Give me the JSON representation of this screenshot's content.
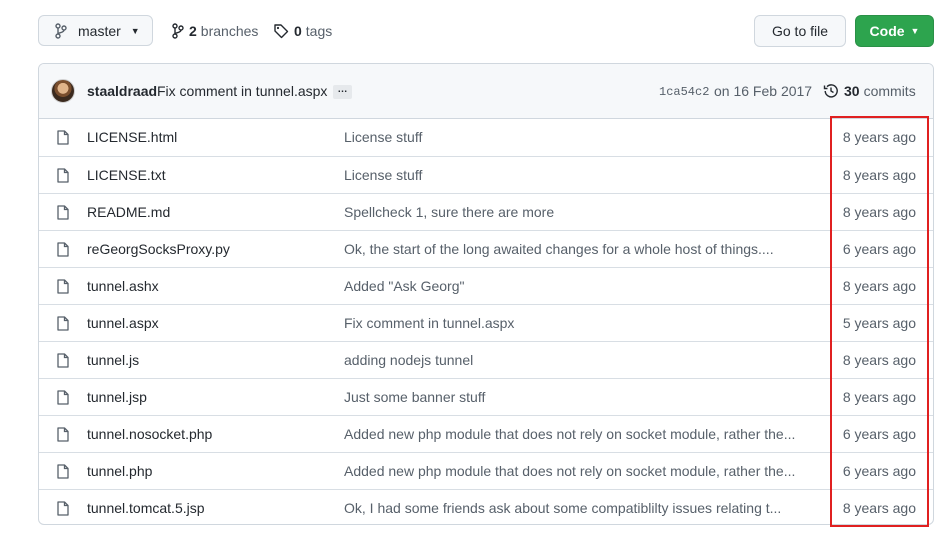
{
  "toolbar": {
    "branch": "master",
    "branches_count": "2",
    "branches_label": "branches",
    "tags_count": "0",
    "tags_label": "tags",
    "goto_file": "Go to file",
    "code": "Code"
  },
  "latest_commit": {
    "author": "staaldraad",
    "message": "Fix comment in tunnel.aspx",
    "ellipsis": "…",
    "sha": "1ca54c2",
    "date": "on 16 Feb 2017",
    "commits_count": "30",
    "commits_label": "commits"
  },
  "files": [
    {
      "name": "LICENSE.html",
      "message": "License stuff",
      "age": "8 years ago"
    },
    {
      "name": "LICENSE.txt",
      "message": "License stuff",
      "age": "8 years ago"
    },
    {
      "name": "README.md",
      "message": "Spellcheck 1, sure there are more",
      "age": "8 years ago"
    },
    {
      "name": "reGeorgSocksProxy.py",
      "message": "Ok, the start of the long awaited changes for a whole host of things....",
      "age": "6 years ago"
    },
    {
      "name": "tunnel.ashx",
      "message": "Added \"Ask Georg\"",
      "age": "8 years ago"
    },
    {
      "name": "tunnel.aspx",
      "message": "Fix comment in tunnel.aspx",
      "age": "5 years ago"
    },
    {
      "name": "tunnel.js",
      "message": "adding nodejs tunnel",
      "age": "8 years ago"
    },
    {
      "name": "tunnel.jsp",
      "message": "Just some banner stuff",
      "age": "8 years ago"
    },
    {
      "name": "tunnel.nosocket.php",
      "message": "Added new php module that does not rely on socket module, rather the...",
      "age": "6 years ago"
    },
    {
      "name": "tunnel.php",
      "message": "Added new php module that does not rely on socket module, rather the...",
      "age": "6 years ago"
    },
    {
      "name": "tunnel.tomcat.5.jsp",
      "message": "Ok, I had some friends ask about some compatiblilty issues relating t...",
      "age": "8 years ago"
    }
  ],
  "colors": {
    "code_button": "#2da44e",
    "highlight": "#e02020"
  },
  "icons": {
    "branch": "git-branch-icon",
    "tag": "tag-icon",
    "history": "history-icon",
    "file": "file-icon"
  }
}
